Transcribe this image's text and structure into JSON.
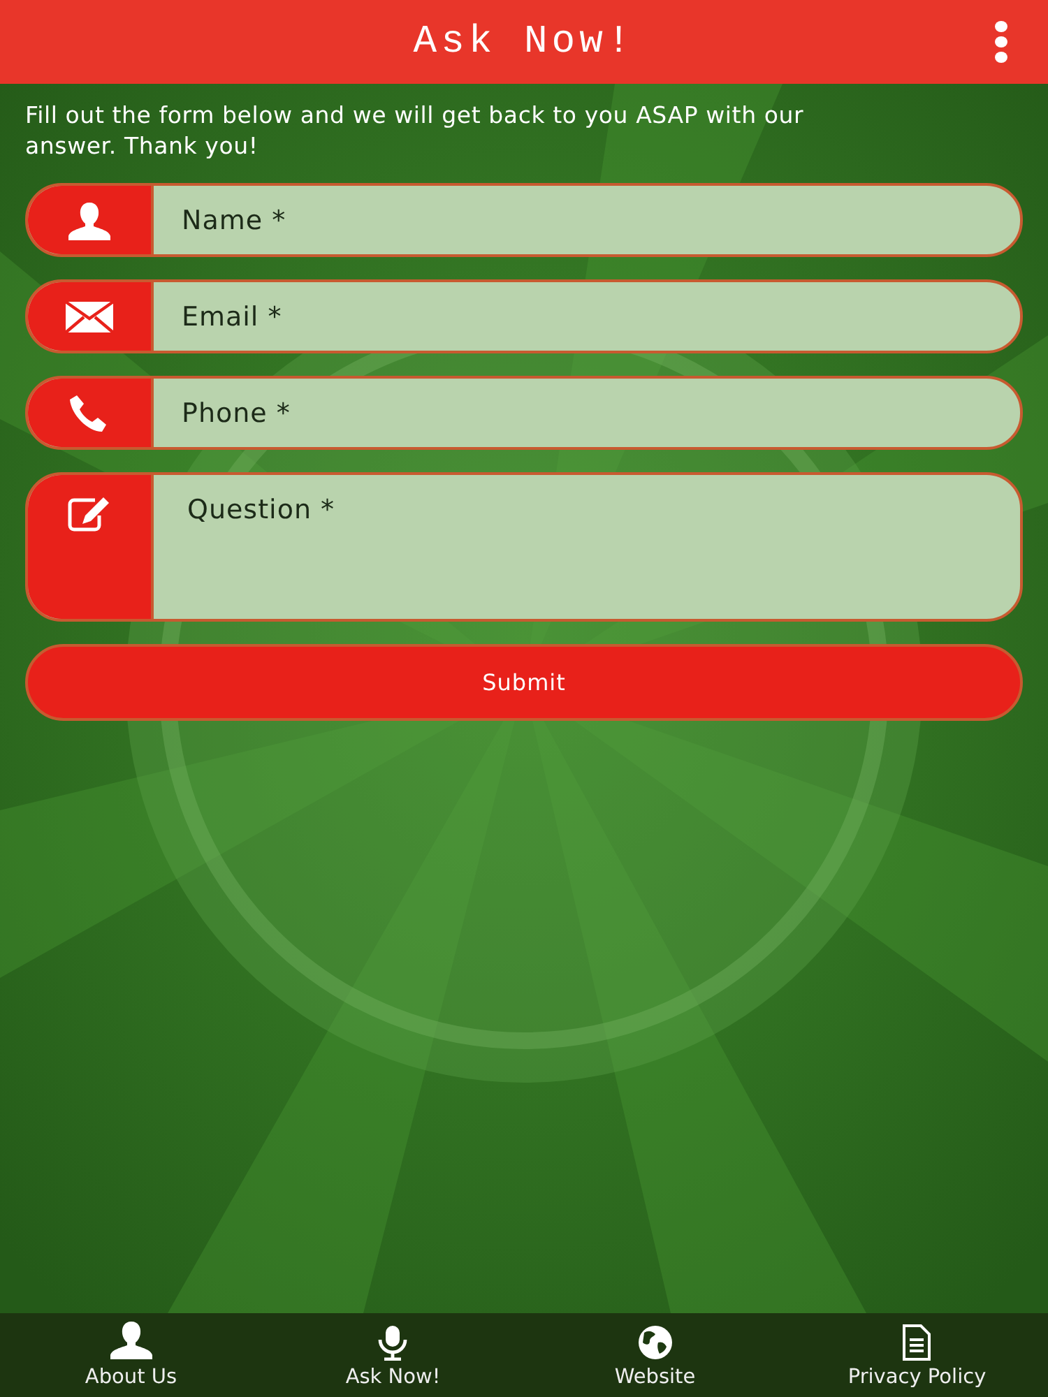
{
  "header": {
    "title": "Ask Now!"
  },
  "intro": "Fill out the form below and we will get back to you ASAP with our answer. Thank you!",
  "fields": [
    {
      "kind": "person",
      "placeholder": "Name *",
      "multiline": false
    },
    {
      "kind": "mail",
      "placeholder": "Email *",
      "multiline": false
    },
    {
      "kind": "phone",
      "placeholder": "Phone *",
      "multiline": false
    },
    {
      "kind": "edit",
      "placeholder": "Question *",
      "multiline": true
    }
  ],
  "submit": "Submit",
  "nav": [
    {
      "kind": "person",
      "label": "About Us"
    },
    {
      "kind": "mic",
      "label": "Ask Now!"
    },
    {
      "kind": "globe",
      "label": "Website"
    },
    {
      "kind": "doc",
      "label": "Privacy Policy"
    }
  ]
}
